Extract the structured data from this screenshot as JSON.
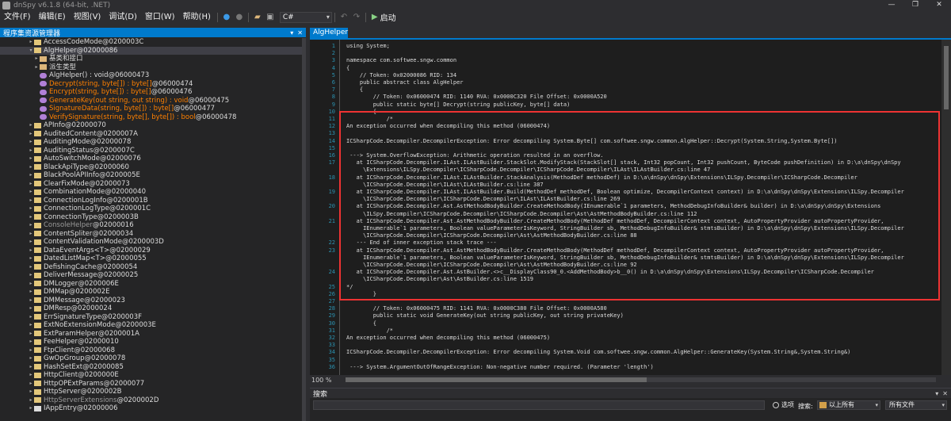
{
  "titlebar": {
    "title": "dnSpy v6.1.8 (64-bit, .NET)",
    "buttons": [
      "—",
      "❐",
      "✕"
    ]
  },
  "menu": [
    "文件(F)",
    "编辑(E)",
    "视图(V)",
    "调试(D)",
    "窗口(W)",
    "帮助(H)"
  ],
  "toolbar": {
    "language": "C#",
    "start_label": "启动"
  },
  "assembly_explorer": {
    "title": "程序集资源管理器",
    "rows": [
      {
        "indent": 5,
        "exp": "▸",
        "icon": "class",
        "name": "AccessCodeMode",
        "id": " @0200003C",
        "color": "#dcdcdc"
      },
      {
        "indent": 5,
        "exp": "▾",
        "icon": "class",
        "name": "AlgHelper",
        "id": " @02000086",
        "color": "#dcdcdc",
        "selected": true
      },
      {
        "indent": 6,
        "exp": "▸",
        "icon": "folder",
        "name": "基类和接口",
        "id": "",
        "color": "#dcdcdc"
      },
      {
        "indent": 6,
        "exp": "▸",
        "icon": "folder",
        "name": "派生类型",
        "id": "",
        "color": "#dcdcdc"
      },
      {
        "indent": 6,
        "exp": "",
        "icon": "method",
        "name": "AlgHelper() : void",
        "id": " @06000473",
        "color": "#dcdcdc"
      },
      {
        "indent": 6,
        "exp": "",
        "icon": "method",
        "name": "Decrypt(string, byte[]) : byte[]",
        "id": " @06000474",
        "color": "#ff8000"
      },
      {
        "indent": 6,
        "exp": "",
        "icon": "method",
        "name": "Encrypt(string, byte[]) : byte[]",
        "id": " @06000476",
        "color": "#ff8000"
      },
      {
        "indent": 6,
        "exp": "",
        "icon": "method",
        "name": "GenerateKey(out string, out string) : void",
        "id": " @06000475",
        "color": "#ff8000"
      },
      {
        "indent": 6,
        "exp": "",
        "icon": "method",
        "name": "SignatureData(string, byte[]) : byte[]",
        "id": " @06000477",
        "color": "#ff8000"
      },
      {
        "indent": 6,
        "exp": "",
        "icon": "method",
        "name": "VerifySignature(string, byte[], byte[]) : bool",
        "id": " @06000478",
        "color": "#ff8000"
      },
      {
        "indent": 5,
        "exp": "▸",
        "icon": "class",
        "name": "APInfo",
        "id": " @02000070",
        "color": "#dcdcdc"
      },
      {
        "indent": 5,
        "exp": "▸",
        "icon": "class",
        "name": "AuditedContent",
        "id": " @0200007A",
        "color": "#dcdcdc"
      },
      {
        "indent": 5,
        "exp": "▸",
        "icon": "class",
        "name": "AuditingMode",
        "id": " @02000078",
        "color": "#dcdcdc"
      },
      {
        "indent": 5,
        "exp": "▸",
        "icon": "class",
        "name": "AuditingStatus",
        "id": " @0200007C",
        "color": "#dcdcdc"
      },
      {
        "indent": 5,
        "exp": "▸",
        "icon": "class",
        "name": "AutoSwitchMode",
        "id": " @02000076",
        "color": "#dcdcdc"
      },
      {
        "indent": 5,
        "exp": "▸",
        "icon": "class",
        "name": "BlackApiType",
        "id": " @02000060",
        "color": "#dcdcdc"
      },
      {
        "indent": 5,
        "exp": "▸",
        "icon": "class",
        "name": "BlackPoolAPIInfo",
        "id": " @0200005E",
        "color": "#dcdcdc"
      },
      {
        "indent": 5,
        "exp": "▸",
        "icon": "class",
        "name": "ClearFixMode",
        "id": " @02000073",
        "color": "#dcdcdc"
      },
      {
        "indent": 5,
        "exp": "▸",
        "icon": "class",
        "name": "CombinationMode",
        "id": " @02000040",
        "color": "#dcdcdc"
      },
      {
        "indent": 5,
        "exp": "▸",
        "icon": "class",
        "name": "ConnectionLogInfo",
        "id": " @0200001B",
        "color": "#dcdcdc"
      },
      {
        "indent": 5,
        "exp": "▸",
        "icon": "class",
        "name": "ConnectionLogType",
        "id": " @0200001C",
        "color": "#dcdcdc"
      },
      {
        "indent": 5,
        "exp": "▸",
        "icon": "class",
        "name": "ConnectionType",
        "id": " @0200003B",
        "color": "#dcdcdc"
      },
      {
        "indent": 5,
        "exp": "▸",
        "icon": "class",
        "name": "ConsoleHelper",
        "id": " @02000016",
        "color": "#9b9b9b"
      },
      {
        "indent": 5,
        "exp": "▸",
        "icon": "class",
        "name": "ContentSpliter",
        "id": " @02000034",
        "color": "#dcdcdc"
      },
      {
        "indent": 5,
        "exp": "▸",
        "icon": "class",
        "name": "ContentValidationMode",
        "id": " @0200003D",
        "color": "#dcdcdc"
      },
      {
        "indent": 5,
        "exp": "▸",
        "icon": "generic",
        "name": "DataEventArgs<T>",
        "id": " @02000029",
        "color": "#dcdcdc"
      },
      {
        "indent": 5,
        "exp": "▸",
        "icon": "generic",
        "name": "DatedListMap<T>",
        "id": " @02000055",
        "color": "#dcdcdc"
      },
      {
        "indent": 5,
        "exp": "▸",
        "icon": "class",
        "name": "DefishingCache",
        "id": " @02000054",
        "color": "#dcdcdc"
      },
      {
        "indent": 5,
        "exp": "▸",
        "icon": "class",
        "name": "DeliverMessage",
        "id": " @02000025",
        "color": "#dcdcdc"
      },
      {
        "indent": 5,
        "exp": "▸",
        "icon": "class",
        "name": "DMLogger",
        "id": " @0200006E",
        "color": "#dcdcdc"
      },
      {
        "indent": 5,
        "exp": "▸",
        "icon": "class",
        "name": "DMMap",
        "id": " @0200002E",
        "color": "#dcdcdc"
      },
      {
        "indent": 5,
        "exp": "▸",
        "icon": "class",
        "name": "DMMessage",
        "id": " @02000023",
        "color": "#dcdcdc"
      },
      {
        "indent": 5,
        "exp": "▸",
        "icon": "class",
        "name": "DMResp",
        "id": " @02000024",
        "color": "#dcdcdc"
      },
      {
        "indent": 5,
        "exp": "▸",
        "icon": "class",
        "name": "ErrSignatureType",
        "id": " @0200003F",
        "color": "#dcdcdc"
      },
      {
        "indent": 5,
        "exp": "▸",
        "icon": "class",
        "name": "ExtNoExtensionMode",
        "id": " @0200003E",
        "color": "#dcdcdc"
      },
      {
        "indent": 5,
        "exp": "▸",
        "icon": "class",
        "name": "ExtParamHelper",
        "id": " @0200001A",
        "color": "#dcdcdc"
      },
      {
        "indent": 5,
        "exp": "▸",
        "icon": "class",
        "name": "FeeHelper",
        "id": " @02000010",
        "color": "#dcdcdc"
      },
      {
        "indent": 5,
        "exp": "▸",
        "icon": "class",
        "name": "FtpClient",
        "id": " @02000068",
        "color": "#dcdcdc"
      },
      {
        "indent": 5,
        "exp": "▸",
        "icon": "class",
        "name": "GwOpGroup",
        "id": " @02000078",
        "color": "#dcdcdc"
      },
      {
        "indent": 5,
        "exp": "▸",
        "icon": "class",
        "name": "HashSetExt",
        "id": " @02000085",
        "color": "#dcdcdc"
      },
      {
        "indent": 5,
        "exp": "▸",
        "icon": "class",
        "name": "HttpClient",
        "id": " @0200000E",
        "color": "#dcdcdc"
      },
      {
        "indent": 5,
        "exp": "▸",
        "icon": "class",
        "name": "HttpOPExtParams",
        "id": " @02000077",
        "color": "#dcdcdc"
      },
      {
        "indent": 5,
        "exp": "▸",
        "icon": "class",
        "name": "HttpServer",
        "id": " @0200002B",
        "color": "#dcdcdc"
      },
      {
        "indent": 5,
        "exp": "▸",
        "icon": "class",
        "name": "HttpServerExtensions",
        "id": " @0200002D",
        "color": "#9b9b9b"
      },
      {
        "indent": 5,
        "exp": "▸",
        "icon": "interface",
        "name": "IAppEntry",
        "id": " @02000006",
        "color": "#dcdcdc"
      }
    ]
  },
  "editor": {
    "tab_label": "AlgHelper",
    "zoom": "100 %",
    "lines": [
      {
        "n": "1",
        "t": "using System;",
        "c": "kw"
      },
      {
        "n": "2",
        "t": "",
        "c": ""
      },
      {
        "n": "3",
        "t": "namespace com.softwee.sngw.common",
        "c": "kw"
      },
      {
        "n": "4",
        "t": "{",
        "c": ""
      },
      {
        "n": "5",
        "t": "    // Token: 0x02000086 RID: 134",
        "c": "cm"
      },
      {
        "n": "6",
        "t": "    public abstract class AlgHelper",
        "c": "kw"
      },
      {
        "n": "7",
        "t": "    {",
        "c": ""
      },
      {
        "n": "8",
        "t": "        // Token: 0x06000474 RID: 1140 RVA: 0x0000C320 File Offset: 0x0000A520",
        "c": "cm"
      },
      {
        "n": "9",
        "t": "        public static byte[] Decrypt(string publicKey, byte[] data)",
        "c": "kw"
      },
      {
        "n": "10",
        "t": "        {",
        "c": ""
      },
      {
        "n": "11",
        "t": "            /*",
        "c": "cm"
      },
      {
        "n": "12",
        "t": "An exception occurred when decompiling this method (06000474)",
        "c": "cm"
      },
      {
        "n": "13",
        "t": "",
        "c": ""
      },
      {
        "n": "14",
        "t": "ICSharpCode.Decompiler.DecompilerException: Error decompiling System.Byte[] com.softwee.sngw.common.AlgHelper::Decrypt(System.String,System.Byte[])",
        "c": "cm"
      },
      {
        "n": "15",
        "t": "",
        "c": ""
      },
      {
        "n": "16",
        "t": " ---> System.OverflowException: Arithmetic operation resulted in an overflow.",
        "c": "cm"
      },
      {
        "n": "17",
        "t": "   at ICSharpCode.Decompiler.ILAst.ILAstBuilder.StackSlot.ModifyStack(StackSlot[] stack, Int32 popCount, Int32 pushCount, ByteCode pushDefinition) in D:\\a\\dnSpy\\dnSpy",
        "c": "cm"
      },
      {
        "n": "",
        "t": "     \\Extensions\\ILSpy.Decompiler\\ICSharpCode.Decompiler\\ICSharpCode.Decompiler\\ILAst\\ILAstBuilder.cs:line 47",
        "c": "cm"
      },
      {
        "n": "18",
        "t": "   at ICSharpCode.Decompiler.ILAst.ILAstBuilder.StackAnalysis(MethodDef methodDef) in D:\\a\\dnSpy\\dnSpy\\Extensions\\ILSpy.Decompiler\\ICSharpCode.Decompiler",
        "c": "cm"
      },
      {
        "n": "",
        "t": "     \\ICSharpCode.Decompiler\\ILAst\\ILAstBuilder.cs:line 387",
        "c": "cm"
      },
      {
        "n": "19",
        "t": "   at ICSharpCode.Decompiler.ILAst.ILAstBuilder.Build(MethodDef methodDef, Boolean optimize, DecompilerContext context) in D:\\a\\dnSpy\\dnSpy\\Extensions\\ILSpy.Decompiler",
        "c": "cm"
      },
      {
        "n": "",
        "t": "     \\ICSharpCode.Decompiler\\ICSharpCode.Decompiler\\ILAst\\ILAstBuilder.cs:line 269",
        "c": "cm"
      },
      {
        "n": "20",
        "t": "   at ICSharpCode.Decompiler.Ast.AstMethodBodyBuilder.CreateMethodBody(IEnumerable`1 parameters, MethodDebugInfoBuilder& builder) in D:\\a\\dnSpy\\dnSpy\\Extensions",
        "c": "cm"
      },
      {
        "n": "",
        "t": "     \\ILSpy.Decompiler\\ICSharpCode.Decompiler\\ICSharpCode.Decompiler\\Ast\\AstMethodBodyBuilder.cs:line 112",
        "c": "cm"
      },
      {
        "n": "21",
        "t": "   at ICSharpCode.Decompiler.Ast.AstMethodBodyBuilder.CreateMethodBody(MethodDef methodDef, DecompilerContext context, AutoPropertyProvider autoPropertyProvider,",
        "c": "cm"
      },
      {
        "n": "",
        "t": "     IEnumerable`1 parameters, Boolean valueParameterIsKeyword, StringBuilder sb, MethodDebugInfoBuilder& stmtsBuilder) in D:\\a\\dnSpy\\dnSpy\\Extensions\\ILSpy.Decompiler",
        "c": "cm"
      },
      {
        "n": "",
        "t": "     \\ICSharpCode.Decompiler\\ICSharpCode.Decompiler\\Ast\\AstMethodBodyBuilder.cs:line 88",
        "c": "cm"
      },
      {
        "n": "22",
        "t": "   --- End of inner exception stack trace ---",
        "c": "cm"
      },
      {
        "n": "23",
        "t": "   at ICSharpCode.Decompiler.Ast.AstMethodBodyBuilder.CreateMethodBody(MethodDef methodDef, DecompilerContext context, AutoPropertyProvider autoPropertyProvider,",
        "c": "cm"
      },
      {
        "n": "",
        "t": "     IEnumerable`1 parameters, Boolean valueParameterIsKeyword, StringBuilder sb, MethodDebugInfoBuilder& stmtsBuilder) in D:\\a\\dnSpy\\dnSpy\\Extensions\\ILSpy.Decompiler",
        "c": "cm"
      },
      {
        "n": "",
        "t": "     \\ICSharpCode.Decompiler\\ICSharpCode.Decompiler\\Ast\\AstMethodBodyBuilder.cs:line 92",
        "c": "cm"
      },
      {
        "n": "24",
        "t": "   at ICSharpCode.Decompiler.Ast.AstBuilder.<>c__DisplayClass90_0.<AddMethodBody>b__0() in D:\\a\\dnSpy\\dnSpy\\Extensions\\ILSpy.Decompiler\\ICSharpCode.Decompiler",
        "c": "cm"
      },
      {
        "n": "",
        "t": "     \\ICSharpCode.Decompiler\\Ast\\AstBuilder.cs:line 1519",
        "c": "cm"
      },
      {
        "n": "25",
        "t": "*/",
        "c": "cm"
      },
      {
        "n": "26",
        "t": "        }",
        "c": ""
      },
      {
        "n": "27",
        "t": "",
        "c": ""
      },
      {
        "n": "28",
        "t": "        // Token: 0x06000475 RID: 1141 RVA: 0x0000C380 File Offset: 0x0000A580",
        "c": "cm"
      },
      {
        "n": "29",
        "t": "        public static void GenerateKey(out string publicKey, out string privateKey)",
        "c": "kw"
      },
      {
        "n": "30",
        "t": "        {",
        "c": ""
      },
      {
        "n": "31",
        "t": "            /*",
        "c": "cm"
      },
      {
        "n": "32",
        "t": "An exception occurred when decompiling this method (06000475)",
        "c": "cm"
      },
      {
        "n": "33",
        "t": "",
        "c": ""
      },
      {
        "n": "34",
        "t": "ICSharpCode.Decompiler.DecompilerException: Error decompiling System.Void com.softwee.sngw.common.AlgHelper::GenerateKey(System.String&,System.String&)",
        "c": "cm"
      },
      {
        "n": "35",
        "t": "",
        "c": ""
      },
      {
        "n": "36",
        "t": " ---> System.ArgumentOutOfRangeException: Non-negative number required. (Parameter 'length')",
        "c": "cm"
      }
    ]
  },
  "search": {
    "title": "搜索",
    "input_value": "",
    "options_label": "选项",
    "search_label": "搜索:",
    "scope_value": "以上所有",
    "type_value": "所有文件"
  },
  "colors": {
    "accent": "#007acc",
    "error_box": "#ee3333"
  }
}
